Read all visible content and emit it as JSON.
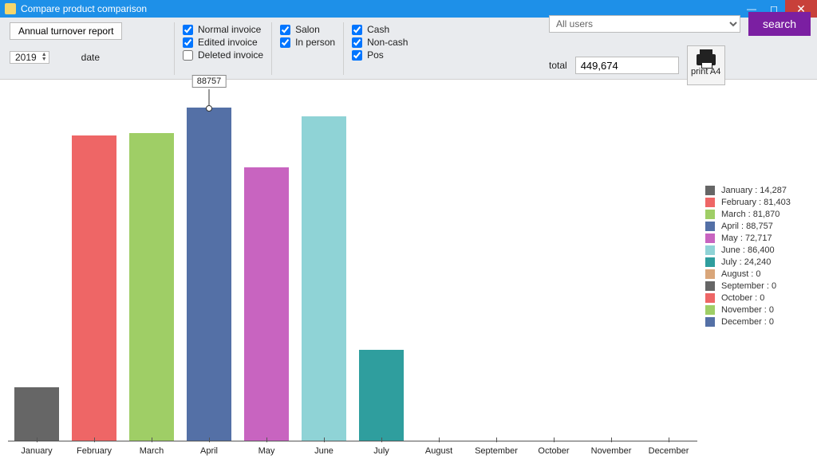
{
  "window": {
    "title": "Compare product comparison"
  },
  "toolbar": {
    "annual_btn": "Annual turnover report",
    "year_value": "2019",
    "date_label": "date",
    "invoice": {
      "normal": {
        "label": "Normal invoice",
        "checked": true
      },
      "edited": {
        "label": "Edited invoice",
        "checked": true
      },
      "deleted": {
        "label": "Deleted invoice",
        "checked": false
      }
    },
    "channel": {
      "salon": {
        "label": "Salon",
        "checked": true
      },
      "inperson": {
        "label": "In person",
        "checked": true
      }
    },
    "payment": {
      "cash": {
        "label": "Cash",
        "checked": true
      },
      "noncash": {
        "label": "Non-cash",
        "checked": true
      },
      "pos": {
        "label": "Pos",
        "checked": true
      }
    },
    "user_combo": "All users",
    "search_btn": "search",
    "total_label": "total",
    "total_value": "449,674",
    "print_label": "print A4"
  },
  "chart_data": {
    "type": "bar",
    "categories": [
      "January",
      "February",
      "March",
      "April",
      "May",
      "June",
      "July",
      "August",
      "September",
      "October",
      "November",
      "December"
    ],
    "values": [
      14287,
      81403,
      81870,
      88757,
      72717,
      86400,
      24240,
      0,
      0,
      0,
      0,
      0
    ],
    "colors": [
      "#666666",
      "#ee6666",
      "#9fce66",
      "#5470a6",
      "#c864c0",
      "#8fd3d6",
      "#2f9e9e",
      "#d9a67a",
      "#666666",
      "#ee6666",
      "#9fce66",
      "#5470a6"
    ],
    "title": "",
    "xlabel": "",
    "ylabel": "",
    "ylim": [
      0,
      90000
    ],
    "highlight": {
      "index": 3,
      "label": "88757"
    }
  },
  "legend_items": [
    {
      "label": "January : 14,287",
      "color": "#666666"
    },
    {
      "label": "February : 81,403",
      "color": "#ee6666"
    },
    {
      "label": "March : 81,870",
      "color": "#9fce66"
    },
    {
      "label": "April : 88,757",
      "color": "#5470a6"
    },
    {
      "label": "May : 72,717",
      "color": "#c864c0"
    },
    {
      "label": "June : 86,400",
      "color": "#8fd3d6"
    },
    {
      "label": "July : 24,240",
      "color": "#2f9e9e"
    },
    {
      "label": "August : 0",
      "color": "#d9a67a"
    },
    {
      "label": "September : 0",
      "color": "#666666"
    },
    {
      "label": "October : 0",
      "color": "#ee6666"
    },
    {
      "label": "November : 0",
      "color": "#9fce66"
    },
    {
      "label": "December : 0",
      "color": "#5470a6"
    }
  ]
}
